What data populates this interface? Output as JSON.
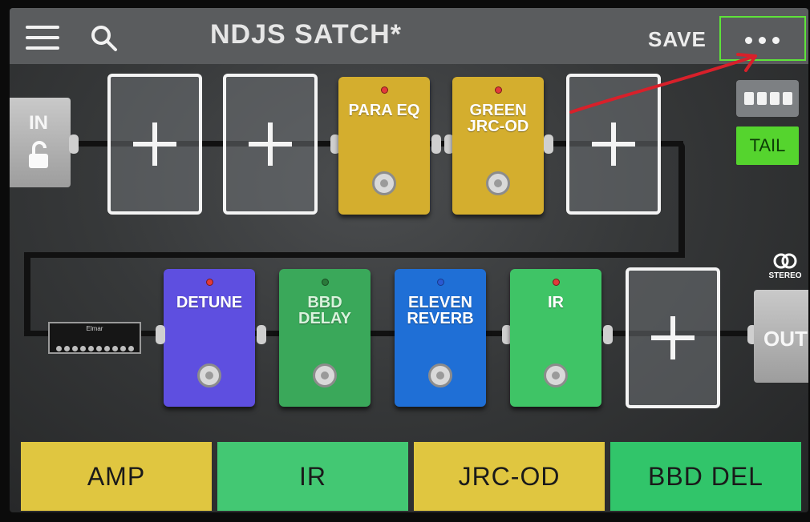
{
  "header": {
    "title": "NDJS SATCH*",
    "save_label": "SAVE"
  },
  "icons": {
    "menu": "hamburger-menu-icon",
    "search": "search-icon",
    "more": "more-options-icon",
    "lock": "lock-open-icon",
    "stereo": "stereo-icon"
  },
  "io": {
    "input_label": "IN",
    "output_label": "OUT",
    "stereo_label": "STEREO"
  },
  "controls": {
    "tail_label": "TAIL"
  },
  "row1": [
    {
      "kind": "empty"
    },
    {
      "kind": "empty"
    },
    {
      "kind": "pedal",
      "label_line1": "PARA EQ",
      "label_line2": "",
      "color": "#d4ae2e",
      "led": "red"
    },
    {
      "kind": "pedal",
      "label_line1": "GREEN",
      "label_line2": "JRC-OD",
      "color": "#d4ae2e",
      "led": "red"
    },
    {
      "kind": "empty"
    }
  ],
  "row2": [
    {
      "kind": "pedal",
      "label_line1": "DETUNE",
      "label_line2": "",
      "color": "#5e4fe0",
      "led": "red"
    },
    {
      "kind": "pedal",
      "label_line1": "BBD",
      "label_line2": "DELAY",
      "color": "#3aa85a",
      "led": "off"
    },
    {
      "kind": "pedal",
      "label_line1": "ELEVEN",
      "label_line2": "REVERB",
      "color": "#1f6fd6",
      "led": "blue"
    },
    {
      "kind": "pedal",
      "label_line1": "IR",
      "label_line2": "",
      "color": "#3fc466",
      "led": "red"
    },
    {
      "kind": "empty"
    }
  ],
  "amp": {
    "brand": "Elmar"
  },
  "bottom_buttons": [
    {
      "label": "AMP",
      "color": "#e0c640"
    },
    {
      "label": "IR",
      "color": "#43c873"
    },
    {
      "label": "JRC-OD",
      "color": "#e0c640"
    },
    {
      "label": "BBD DEL",
      "color": "#31c56a"
    }
  ],
  "colors": {
    "highlight": "#5ee33a",
    "tail_active": "#55d42e",
    "annotation": "#d8202a"
  }
}
